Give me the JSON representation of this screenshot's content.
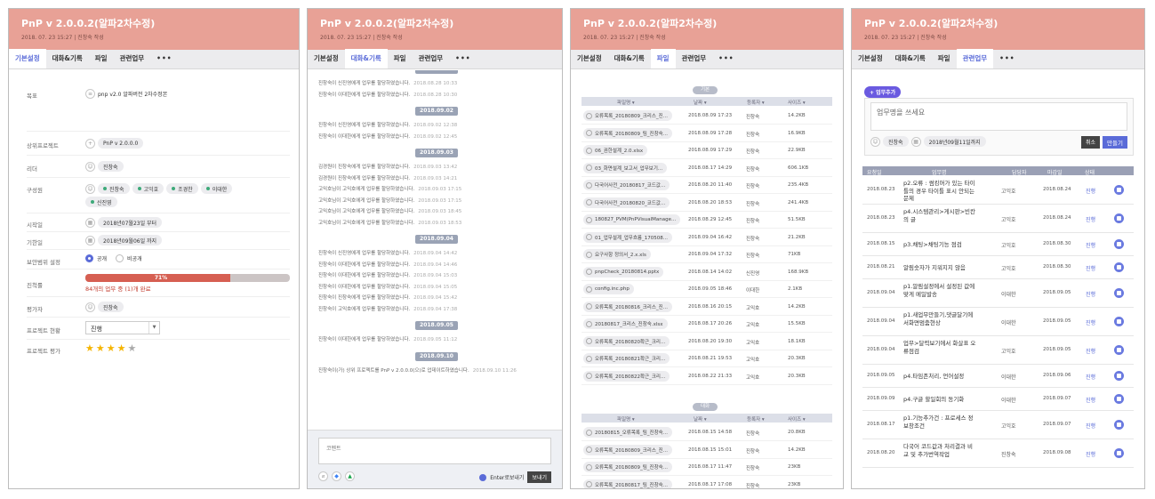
{
  "title": "PnP v 2.0.0.2(알파2차수정)",
  "subtitle": "2018. 07. 23 15:27 | 진창숙 작성",
  "tabs": [
    "기본설정",
    "대화&기록",
    "파일",
    "관련업무",
    "•••"
  ],
  "basic": {
    "goal_label": "목표",
    "goal_value": "pnp v2.0 알파버전 2차수정본",
    "parent_label": "상위프로젝트",
    "parent_value": "PnP v 2.0.0.0",
    "leader_label": "리더",
    "leader_value": "진창숙",
    "members_label": "구성원",
    "members": [
      "진창숙",
      "고익호",
      "조경찬",
      "이대한",
      "신진영"
    ],
    "start_label": "시작일",
    "start_value": "2018년07월23일 부터",
    "end_label": "기한일",
    "end_value": "2018년09월06일 까지",
    "scope_label": "보안범위 설정",
    "scope_public": "공개",
    "scope_private": "비공개",
    "progress_label": "진척률",
    "progress_value": "71%",
    "progress_fraction": 0.71,
    "progress_note": "84개의 업무 중 (1)개 완료",
    "reviewer_label": "평가자",
    "reviewer_value": "진창숙",
    "status_label": "프로젝트 현황",
    "status_value": "진행",
    "rating_label": "프로젝트 평가",
    "rating_stars": 4,
    "rating_max": 5
  },
  "chat": {
    "groups": [
      {
        "date": "2018.08.28",
        "logs": [
          {
            "text": "진창숙이 신진영에게 업무를 할당하였습니다.",
            "time": "2018.08.28 10:33"
          },
          {
            "text": "진창숙이 이대한에게 업무를 할당하였습니다.",
            "time": "2018.08.28 10:30"
          }
        ]
      },
      {
        "date": "2018.09.02",
        "logs": [
          {
            "text": "진창숙이 신진영에게 업무를 할당하였습니다.",
            "time": "2018.09.02 12:38"
          },
          {
            "text": "진창숙이 이대한에게 업무를 할당하였습니다.",
            "time": "2018.09.02 12:45"
          }
        ]
      },
      {
        "date": "2018.09.03",
        "logs": [
          {
            "text": "김경원이 진창숙에게 업무를 할당하였습니다.",
            "time": "2018.09.03 13:42"
          },
          {
            "text": "김경원이 진창숙에게 업무를 할당하였습니다.",
            "time": "2018.09.03 14:21"
          },
          {
            "text": "고익호님이 고익호에게 업무를 할당하였습니다.",
            "time": "2018.09.03 17:15"
          },
          {
            "text": "고익호님이 고익호에게 업무를 할당하였습니다.",
            "time": "2018.09.03 17:15"
          },
          {
            "text": "고익호님이 고익호에게 업무를 할당하였습니다.",
            "time": "2018.09.03 18:45"
          },
          {
            "text": "고익호님이 고익호에게 업무를 할당하였습니다.",
            "time": "2018.09.03 18:53"
          }
        ]
      },
      {
        "date": "2018.09.04",
        "logs": [
          {
            "text": "진창숙이 신진영에게 업무를 할당하였습니다.",
            "time": "2018.09.04 14:42"
          },
          {
            "text": "진창숙이 이대한에게 업무를 할당하였습니다.",
            "time": "2018.09.04 14:46"
          },
          {
            "text": "진창숙이 이대한에게 업무를 할당하였습니다.",
            "time": "2018.09.04 15:03"
          },
          {
            "text": "진창숙이 이대한에게 업무를 할당하였습니다.",
            "time": "2018.09.04 15:05"
          },
          {
            "text": "진창숙이 진창숙에게 업무를 할당하였습니다.",
            "time": "2018.09.04 15:42"
          },
          {
            "text": "진창숙이 고익호에게 업무를 할당하였습니다.",
            "time": "2018.09.04 17:38"
          }
        ]
      },
      {
        "date": "2018.09.05",
        "logs": [
          {
            "text": "진창숙이 이대한에게 업무를 할당하였습니다.",
            "time": "2018.09.05 11:12"
          }
        ]
      },
      {
        "date": "2018.09.10",
        "logs": [
          {
            "text": "진창숙이(가) 상위 프로젝트를 PnP v 2.0.0.0(으)로 업데이트하였습니다.",
            "time": "2018.09.10 11:26"
          }
        ]
      }
    ],
    "comment_placeholder": "코멘트",
    "enter_send": "Enter로보내기",
    "send_button": "보내기"
  },
  "files": {
    "basic_label": "기본",
    "chat_label": "대화",
    "headers": [
      "파일명 ▾",
      "날짜 ▾",
      "등록자 ▾",
      "사이즈 ▾"
    ],
    "basic_rows": [
      [
        "오류목록_20180809_크리스_진...",
        "2018.08.09 17:23",
        "진창숙",
        "14.2KB"
      ],
      [
        "오류목록_20180809_팀_진창숙...",
        "2018.08.09 17:28",
        "진창숙",
        "16.9KB"
      ],
      [
        "06_권한설계_2.0.xlsx",
        "2018.08.09 17:29",
        "진창숙",
        "22.9KB"
      ],
      [
        "03_화면설계_보고서_업무보기...",
        "2018.08.17 14:29",
        "진창숙",
        "606.1KB"
      ],
      [
        "다국어사전_20180817_코드값...",
        "2018.08.20 11:40",
        "진창숙",
        "235.4KB"
      ],
      [
        "다국어사전_20180820_코드값...",
        "2018.08.20 18:53",
        "진창숙",
        "241.4KB"
      ],
      [
        "180827_PVM(PnPVisualManage...",
        "2018.08.29 12:45",
        "진창숙",
        "51.5KB"
      ],
      [
        "01_업무설계_업무흐름_170508...",
        "2018.09.04 16:42",
        "진창숙",
        "21.2KB"
      ],
      [
        "요구사항 정의서_2.x.xls",
        "2018.09.04 17:32",
        "진창숙",
        "71KB"
      ],
      [
        "pnpCheck_20180814.pptx",
        "2018.08.14 14:02",
        "신진영",
        "168.9KB"
      ],
      [
        "config.inc.php",
        "2018.09.05 18:46",
        "이대한",
        "2.1KB"
      ],
      [
        "오류목록_20180816_크리스_진...",
        "2018.08.16 20:15",
        "고익호",
        "14.2KB"
      ],
      [
        "20180817_크리스_진창숙.xlsx",
        "2018.08.17 20:26",
        "고익호",
        "15.5KB"
      ],
      [
        "오류목록_20180820확근_크리...",
        "2018.08.20 19:30",
        "고익호",
        "18.1KB"
      ],
      [
        "오류목록_20180821확근_크리...",
        "2018.08.21 19:53",
        "고익호",
        "20.3KB"
      ],
      [
        "오류목록_20180822확근_크리...",
        "2018.08.22 21:33",
        "고익호",
        "20.3KB"
      ]
    ],
    "chat_rows": [
      [
        "20180815_오류목록_팀_진창숙...",
        "2018.08.15 14:58",
        "진창숙",
        "20.8KB"
      ],
      [
        "오류목록_20180809_크리스_진...",
        "2018.08.15 15:01",
        "진창숙",
        "14.2KB"
      ],
      [
        "오류목록_20180809_팀_진창숙...",
        "2018.08.17 11:47",
        "진창숙",
        "23KB"
      ],
      [
        "오류목록_20180817_팀_진창숙...",
        "2018.08.17 17:08",
        "진창숙",
        "23KB"
      ]
    ]
  },
  "related": {
    "add_button": "+ 업무추가",
    "task_placeholder": "업무명을 쓰세요",
    "assignee": "진창숙",
    "due": "2018년09월11일까지",
    "cancel": "취소",
    "create": "만들기",
    "headers": [
      "요청일",
      "업무명",
      "담당자",
      "마감일",
      "상태"
    ],
    "rows": [
      [
        "2018.08.23",
        "p2.오류 : 썸킹머가 있는 타이틀의 경우 타이틀 표시 안되는 문제",
        "고익호",
        "2018.08.24",
        "진행"
      ],
      [
        "2018.08.23",
        "p4.시스템관리>게시판>빈칸의 글",
        "고익호",
        "2018.08.24",
        "진행"
      ],
      [
        "2018.08.15",
        "p3.채팅>채팅기능 점검",
        "고익호",
        "2018.08.30",
        "진행"
      ],
      [
        "2018.08.21",
        "알림숫자가 지워지지 않음",
        "고익호",
        "2018.08.30",
        "진행"
      ],
      [
        "2018.09.04",
        "p1.알림설정에서 설정된 값에 맞게 메일발송",
        "이대한",
        "2018.09.05",
        "진행"
      ],
      [
        "2018.09.04",
        "p1.새업무만들기,댓글달기에서화면멈춤현상",
        "이대한",
        "2018.09.05",
        "진행"
      ],
      [
        "2018.09.04",
        "업무>달력보기에서 화살표 오류점검",
        "고익호",
        "2018.09.05",
        "진행"
      ],
      [
        "2018.09.05",
        "p4.타임존처리, 언어설정",
        "이대한",
        "2018.09.06",
        "진행"
      ],
      [
        "2018.09.09",
        "p4.구글 할일회의 동기화",
        "이대한",
        "2018.09.07",
        "진행"
      ],
      [
        "2018.08.17",
        "p1.기능추가건 : 프로세스 정보창조건",
        "고익호",
        "2018.09.07",
        "진행"
      ],
      [
        "2018.08.20",
        "다국어 코드값과 처리결과 비교 및 추가번역작업",
        "진창숙",
        "2018.09.08",
        "진행"
      ]
    ]
  }
}
